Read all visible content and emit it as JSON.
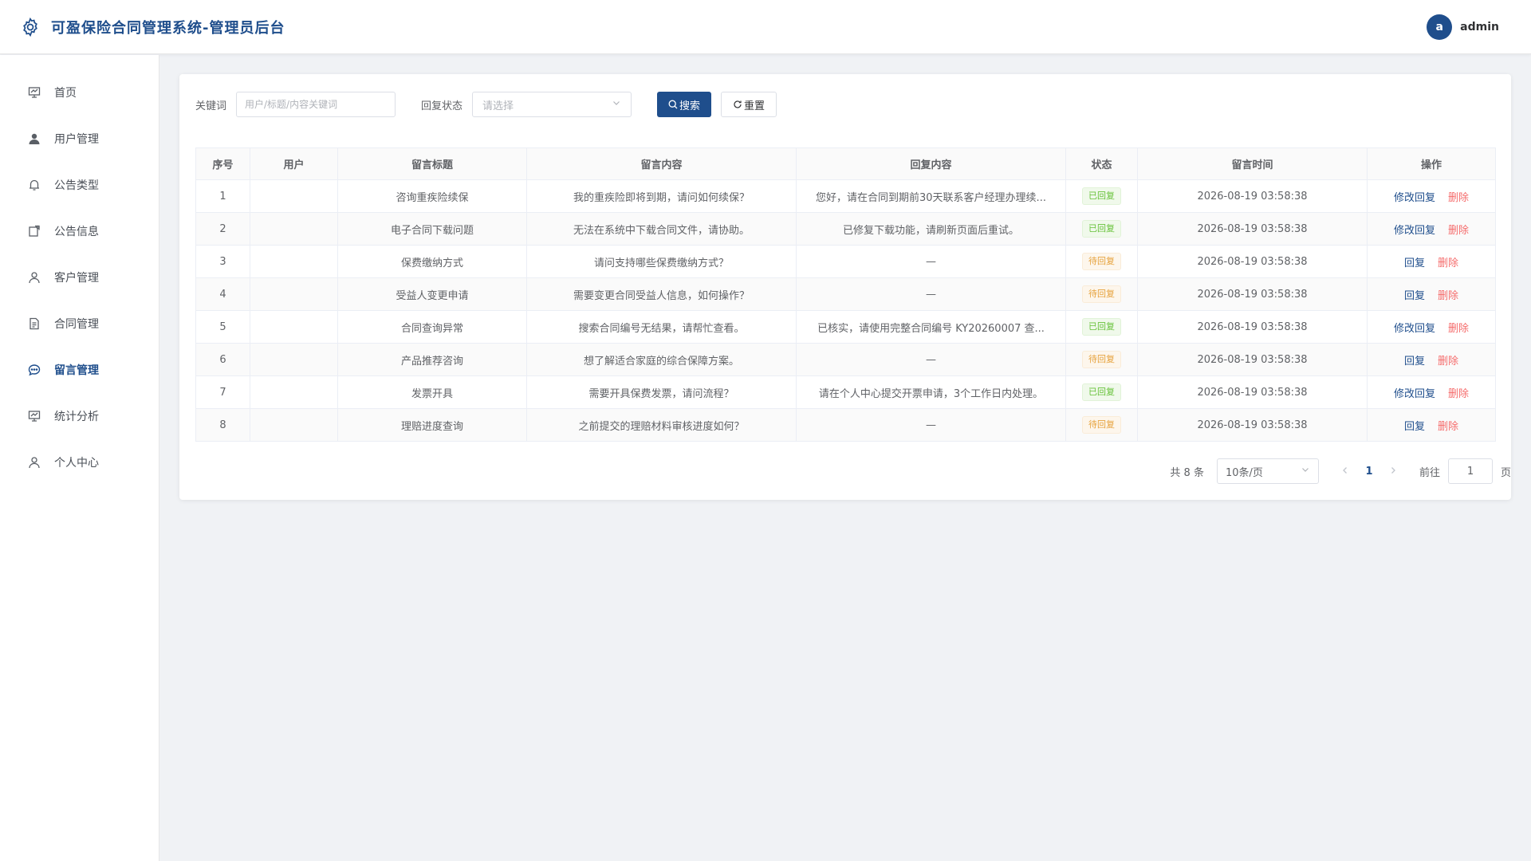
{
  "header": {
    "title": "可盈保险合同管理系统-管理员后台",
    "avatar_letter": "a",
    "username": "admin"
  },
  "sidebar": {
    "items": [
      {
        "label": "首页",
        "icon": "chart-board-icon"
      },
      {
        "label": "用户管理",
        "icon": "user-filled-icon"
      },
      {
        "label": "公告类型",
        "icon": "bell-icon"
      },
      {
        "label": "公告信息",
        "icon": "notice-icon"
      },
      {
        "label": "客户管理",
        "icon": "user-icon"
      },
      {
        "label": "合同管理",
        "icon": "document-icon"
      },
      {
        "label": "留言管理",
        "icon": "chat-icon",
        "active": true
      },
      {
        "label": "统计分析",
        "icon": "chart-board-icon"
      },
      {
        "label": "个人中心",
        "icon": "user-icon"
      }
    ]
  },
  "filters": {
    "keyword_label": "关键词",
    "keyword_placeholder": "用户/标题/内容关键词",
    "keyword_value": "",
    "status_label": "回复状态",
    "status_placeholder": "请选择",
    "search_label": "搜索",
    "reset_label": "重置"
  },
  "table": {
    "columns": [
      "序号",
      "用户",
      "留言标题",
      "留言内容",
      "回复内容",
      "状态",
      "留言时间",
      "操作"
    ],
    "rows": [
      {
        "no": "1",
        "user": "",
        "title": "咨询重疾险续保",
        "content": "我的重疾险即将到期，请问如何续保？",
        "reply": "您好，请在合同到期前30天联系客户经理办理续...",
        "status": "已回复",
        "status_type": "done",
        "time": "2026-08-19 03:58:38",
        "action": "修改回复",
        "delete": "删除"
      },
      {
        "no": "2",
        "user": "",
        "title": "电子合同下载问题",
        "content": "无法在系统中下载合同文件，请协助。",
        "reply": "已修复下载功能，请刷新页面后重试。",
        "status": "已回复",
        "status_type": "done",
        "time": "2026-08-19 03:58:38",
        "action": "修改回复",
        "delete": "删除"
      },
      {
        "no": "3",
        "user": "",
        "title": "保费缴纳方式",
        "content": "请问支持哪些保费缴纳方式？",
        "reply": "—",
        "status": "待回复",
        "status_type": "pending",
        "time": "2026-08-19 03:58:38",
        "action": "回复",
        "delete": "删除"
      },
      {
        "no": "4",
        "user": "",
        "title": "受益人变更申请",
        "content": "需要变更合同受益人信息，如何操作？",
        "reply": "—",
        "status": "待回复",
        "status_type": "pending",
        "time": "2026-08-19 03:58:38",
        "action": "回复",
        "delete": "删除"
      },
      {
        "no": "5",
        "user": "",
        "title": "合同查询异常",
        "content": "搜索合同编号无结果，请帮忙查看。",
        "reply": "已核实，请使用完整合同编号 KY20260007 查...",
        "status": "已回复",
        "status_type": "done",
        "time": "2026-08-19 03:58:38",
        "action": "修改回复",
        "delete": "删除"
      },
      {
        "no": "6",
        "user": "",
        "title": "产品推荐咨询",
        "content": "想了解适合家庭的综合保障方案。",
        "reply": "—",
        "status": "待回复",
        "status_type": "pending",
        "time": "2026-08-19 03:58:38",
        "action": "回复",
        "delete": "删除"
      },
      {
        "no": "7",
        "user": "",
        "title": "发票开具",
        "content": "需要开具保费发票，请问流程？",
        "reply": "请在个人中心提交开票申请，3个工作日内处理。",
        "status": "已回复",
        "status_type": "done",
        "time": "2026-08-19 03:58:38",
        "action": "修改回复",
        "delete": "删除"
      },
      {
        "no": "8",
        "user": "",
        "title": "理赔进度查询",
        "content": "之前提交的理赔材料审核进度如何？",
        "reply": "—",
        "status": "待回复",
        "status_type": "pending",
        "time": "2026-08-19 03:58:38",
        "action": "回复",
        "delete": "删除"
      }
    ]
  },
  "pagination": {
    "total_text": "共 8 条",
    "page_size": "10条/页",
    "current_page": "1",
    "goto_label": "前往",
    "goto_value": "1",
    "page_suffix": "页"
  },
  "colors": {
    "primary": "#1f4e8c",
    "success": "#67c23a",
    "warning": "#e6a23c",
    "danger": "#f56c6c"
  }
}
